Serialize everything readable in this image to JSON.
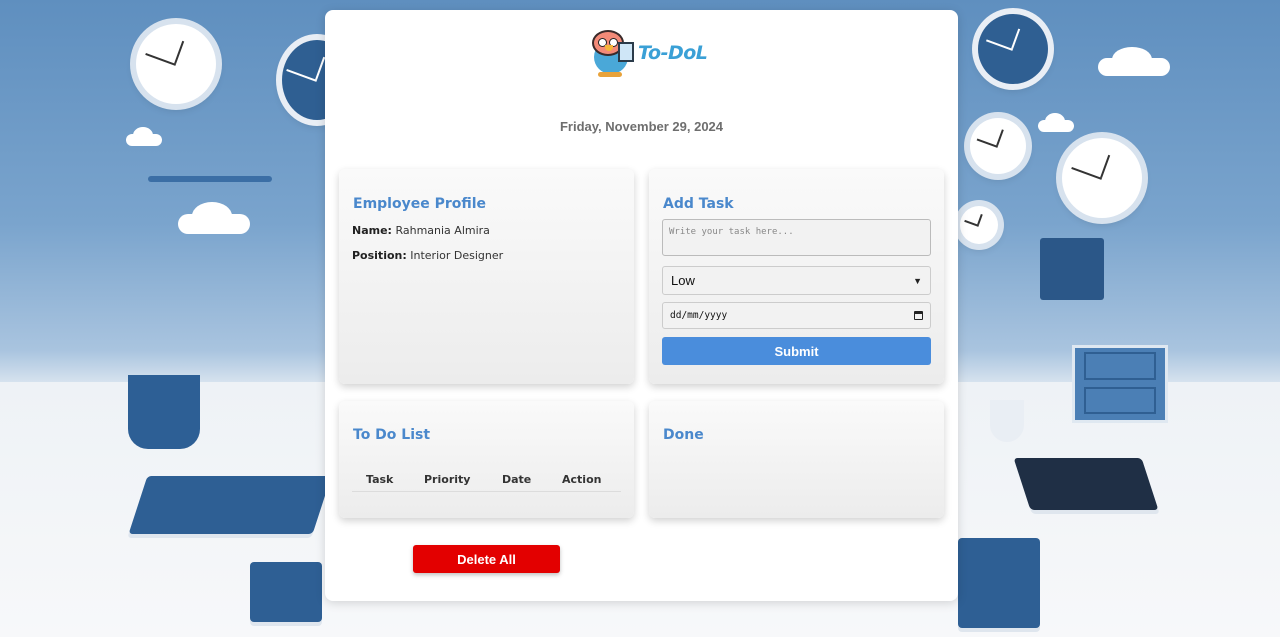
{
  "app": {
    "logo_text": "To-DoL"
  },
  "header": {
    "date": "Friday, November 29, 2024"
  },
  "profile": {
    "title": "Employee Profile",
    "name_label": "Name:",
    "name_value": "Rahmania Almira",
    "position_label": "Position:",
    "position_value": "Interior Designer"
  },
  "add_task": {
    "title": "Add Task",
    "task_placeholder": "Write your task here...",
    "priority_selected": "Low",
    "date_placeholder": "dd/mm/yyyy",
    "submit_label": "Submit"
  },
  "todo": {
    "title": "To Do List",
    "columns": [
      "Task",
      "Priority",
      "Date",
      "Action"
    ]
  },
  "done": {
    "title": "Done"
  },
  "actions": {
    "delete_all_label": "Delete All"
  },
  "colors": {
    "accent": "#4a8ddc",
    "heading": "#4a88cc",
    "danger": "#e30000"
  },
  "icons": {
    "select_chevron": "chevron-down-icon",
    "calendar": "calendar-icon",
    "logo": "bird-mascot-icon"
  }
}
